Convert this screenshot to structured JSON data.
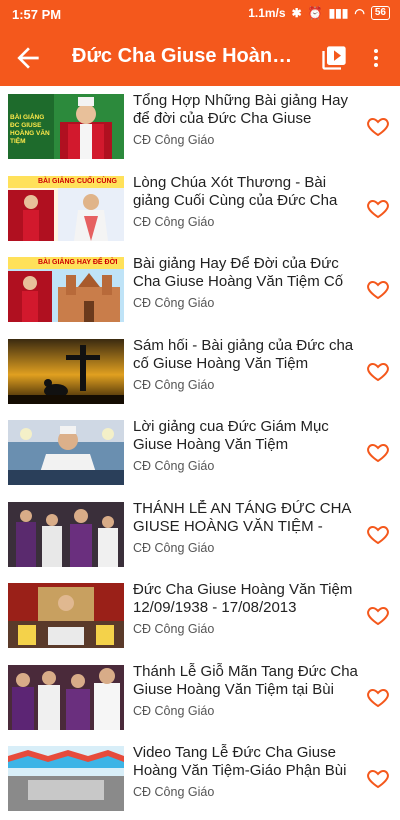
{
  "status": {
    "time": "1:57 PM",
    "speed": "1.1m/s",
    "battery": "56"
  },
  "appbar": {
    "title": "Đức Cha Giuse Hoàng Văn Tiệm"
  },
  "colors": {
    "accent": "#f4581c",
    "heart": "#f4581c"
  },
  "videos": [
    {
      "title": "Tổng Hợp Những Bài giảng Hay để đời của Đức Cha Giuse Hoàng",
      "channel": "CĐ Công Giáo",
      "thumb_text": "BÀI GIẢNG ĐC GIUSE HOÀNG VĂN TIỆM"
    },
    {
      "title": "Lòng Chúa Xót Thương - Bài giảng Cuối Cùng của Đức Cha",
      "channel": "CĐ Công Giáo",
      "thumb_text": "BÀI GIẢNG CUỐI CÙNG"
    },
    {
      "title": "Bài giảng Hay Để Đời của Đức Cha Giuse Hoàng Văn Tiệm Cố",
      "channel": "CĐ Công Giáo",
      "thumb_text": "BÀI GIẢNG HAY ĐỂ ĐỜI"
    },
    {
      "title": "Sám hối - Bài giảng của Đức cha cố Giuse Hoàng Văn Tiệm",
      "channel": "CĐ Công Giáo"
    },
    {
      "title": "Lời giảng cua Đức Giám Mục Giuse Hoàng Văn Tiệm",
      "channel": "CĐ Công Giáo"
    },
    {
      "title": "THÁNH LỄ AN TÁNG ĐỨC CHA GIUSE HOÀNG VĂN TIỆM - GIÁM",
      "channel": "CĐ Công Giáo"
    },
    {
      "title": "Đức Cha Giuse Hoàng Văn Tiệm 12/09/1938 - 17/08/2013",
      "channel": "CĐ Công Giáo"
    },
    {
      "title": "Thánh Lễ Giỗ Mãn Tang Đức Cha Giuse Hoàng Văn Tiệm tại Bùi",
      "channel": "CĐ Công Giáo"
    },
    {
      "title": "Video Tang Lễ Đức Cha Giuse Hoàng Văn Tiệm-Giáo Phận Bùi",
      "channel": "CĐ Công Giáo"
    }
  ]
}
